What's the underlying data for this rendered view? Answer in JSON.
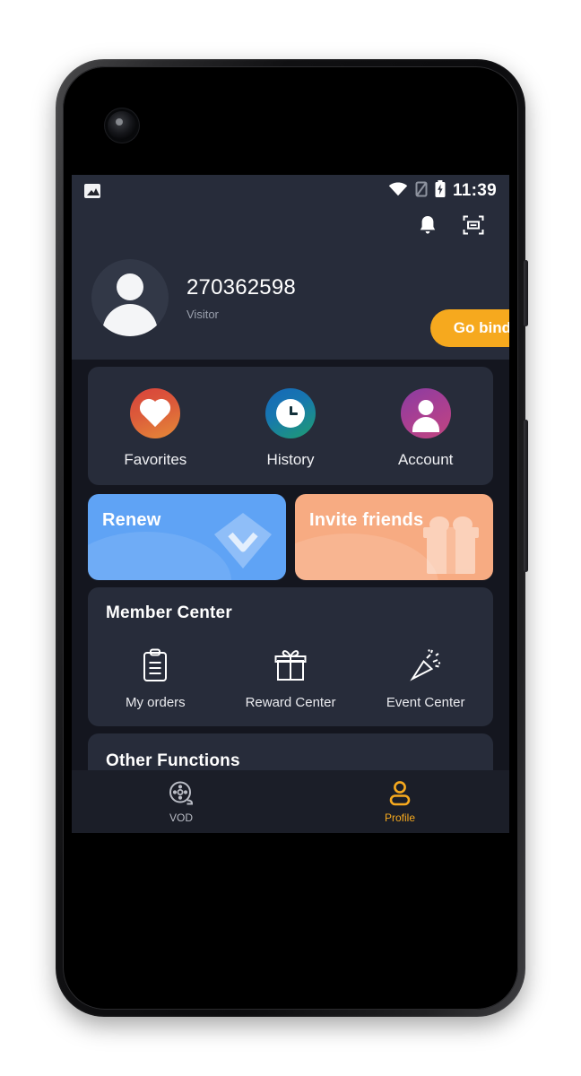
{
  "device": {
    "type": "android-phone-mockup",
    "camera": "front-camera-hole",
    "buttons": [
      "volume-button",
      "power-button"
    ]
  },
  "status_bar": {
    "left_icons": [
      "image-notification-icon"
    ],
    "right_icons": [
      "wifi-icon",
      "signal-off-icon",
      "battery-charging-icon"
    ],
    "time": "11:39"
  },
  "top_actions": {
    "items": [
      {
        "name": "notifications-bell-icon",
        "label": "Notifications"
      },
      {
        "name": "scan-frame-icon",
        "label": "Scan"
      }
    ]
  },
  "profile": {
    "avatar": "default-user-avatar",
    "user_name": "270362598",
    "user_role": "Visitor",
    "bind_button": "Go bind",
    "bind_button_color": "#f6a91e"
  },
  "quick_actions": [
    {
      "label": "Favorites",
      "icon": "heart-icon",
      "color_from": "#d8433c",
      "color_to": "#e58b38"
    },
    {
      "label": "History",
      "icon": "clock-icon",
      "color_from": "#1668b8",
      "color_to": "#1f9e70"
    },
    {
      "label": "Account",
      "icon": "person-icon",
      "color_from": "#8a3ca2",
      "color_to": "#c2457f"
    }
  ],
  "promos": [
    {
      "title": "Renew",
      "art": "diamond-icon",
      "color": "#5fa3f5"
    },
    {
      "title": "Invite friends",
      "art": "gift-icon",
      "color": "#f7ab82"
    }
  ],
  "member_center": {
    "title": "Member Center",
    "items": [
      {
        "label": "My orders",
        "icon": "clipboard-icon"
      },
      {
        "label": "Reward Center",
        "icon": "gift-icon"
      },
      {
        "label": "Event Center",
        "icon": "party-popper-icon"
      }
    ]
  },
  "other_functions": {
    "title": "Other Functions"
  },
  "bottom_nav": {
    "active": "Profile",
    "active_color": "#f6a91e",
    "items": [
      {
        "label": "VOD",
        "icon": "film-reel-icon",
        "active": false
      },
      {
        "label": "Profile",
        "icon": "person-outline-icon",
        "active": true
      }
    ]
  }
}
